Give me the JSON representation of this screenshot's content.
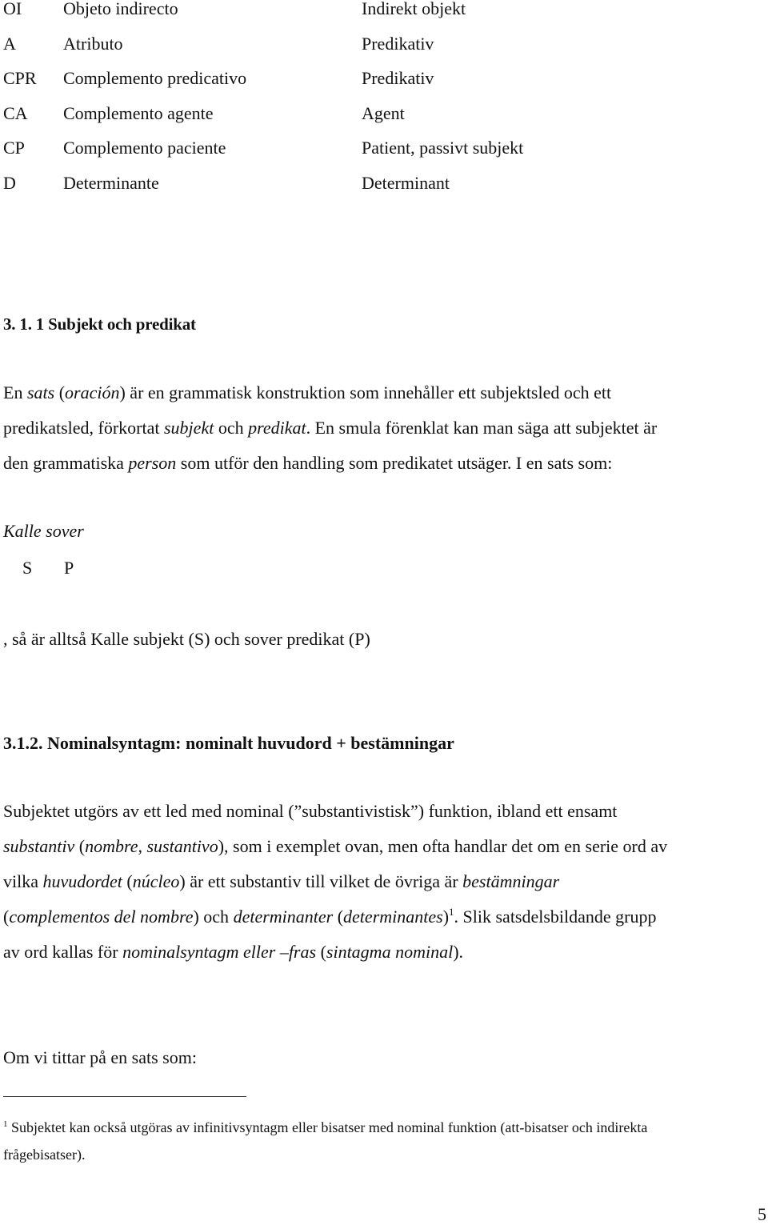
{
  "abbreviations": [
    {
      "code": "OI",
      "spanish": "Objeto indirecto",
      "swedish": "Indirekt objekt"
    },
    {
      "code": "A",
      "spanish": "Atributo",
      "swedish": "Predikativ"
    },
    {
      "code": "CPR",
      "spanish": "Complemento predicativo",
      "swedish": "Predikativ"
    },
    {
      "code": "CA",
      "spanish": "Complemento agente",
      "swedish": "Agent"
    },
    {
      "code": "CP",
      "spanish": "Complemento paciente",
      "swedish": "Patient, passivt subjekt"
    },
    {
      "code": "D",
      "spanish": "Determinante",
      "swedish": "Determinant"
    }
  ],
  "section_1": {
    "heading": "3. 1. 1 Subjekt och predikat",
    "para": {
      "l1a": "En ",
      "l1b": "sats",
      "l1c": " (",
      "l1d": "oración",
      "l1e": ") är en grammatisk konstruktion som innehåller ett subjektsled och ett",
      "l2a": "predikatsled, förkortat ",
      "l2b": "subjekt",
      "l2c": " och ",
      "l2d": "predikat",
      "l2e": ". En smula förenklat kan man säga att subjektet är",
      "l3a": "den grammatiska ",
      "l3b": "person",
      "l3c": " som utför den handling som predikatet utsäger. I en sats som:"
    },
    "example": {
      "sentence": "Kalle sover",
      "label_s": "S",
      "label_p": "P"
    },
    "conclusion": ", så är alltså Kalle subjekt (S) och sover predikat (P)"
  },
  "section_2": {
    "heading": "3.1.2. Nominalsyntagm: nominalt huvudord + bestämningar",
    "para": {
      "l1": "Subjektet utgörs av ett led med nominal (”substantivistisk”) funktion, ibland ett ensamt",
      "l2a": "substantiv",
      "l2b": " (",
      "l2c": "nombre",
      "l2d": ", ",
      "l2e": "sustantivo",
      "l2f": "), som i exemplet ovan, men ofta handlar det om en serie ord av",
      "l3a": "vilka ",
      "l3b": "huvudordet",
      "l3c": " (",
      "l3d": "núcleo",
      "l3e": ") är ett substantiv till vilket de övriga är ",
      "l3f": "bestämningar",
      "l4a": "(",
      "l4b": "complementos del nombre",
      "l4c": ") och ",
      "l4d": "determinanter",
      "l4e": " (",
      "l4f": "determinantes",
      "l4g": ")",
      "l4sup": "1",
      "l4h": ". Slik satsdelsbildande grupp",
      "l5a": "av ord kallas för ",
      "l5b": "nominalsyntagm eller –fras",
      "l5c": " (",
      "l5d": "sintagma nominal",
      "l5e": ")."
    },
    "lead_in": "Om vi tittar på en sats som:"
  },
  "footnote": {
    "marker": "1",
    "line1": " Subjektet kan också utgöras av infinitivsyntagm eller bisatser med nominal funktion (att-bisatser och indirekta",
    "line2": "frågebisatser)."
  },
  "page_number": "5"
}
